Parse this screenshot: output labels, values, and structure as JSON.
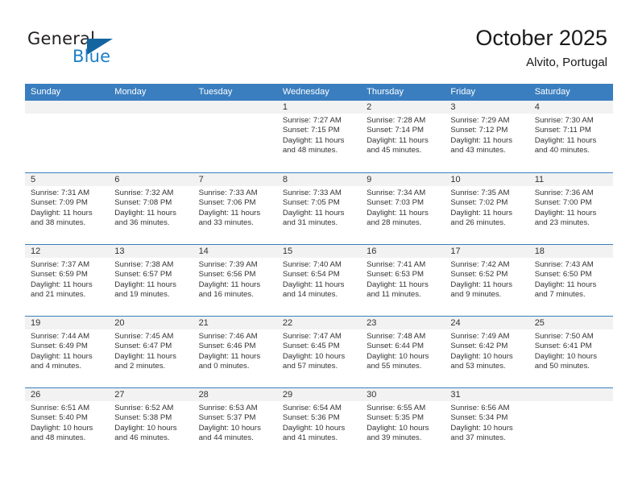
{
  "brand": {
    "name_part1": "General",
    "name_part2": "Blue",
    "accent_color": "#1f7fc4",
    "triangle_color": "#14659f"
  },
  "header": {
    "title": "October 2025",
    "subtitle": "Alvito, Portugal"
  },
  "calendar": {
    "header_bg": "#3a7ebf",
    "weekdays": [
      "Sunday",
      "Monday",
      "Tuesday",
      "Wednesday",
      "Thursday",
      "Friday",
      "Saturday"
    ],
    "weeks": [
      [
        {
          "day": "",
          "sunrise": "",
          "sunset": "",
          "daylight_line1": "",
          "daylight_line2": ""
        },
        {
          "day": "",
          "sunrise": "",
          "sunset": "",
          "daylight_line1": "",
          "daylight_line2": ""
        },
        {
          "day": "",
          "sunrise": "",
          "sunset": "",
          "daylight_line1": "",
          "daylight_line2": ""
        },
        {
          "day": "1",
          "sunrise": "Sunrise: 7:27 AM",
          "sunset": "Sunset: 7:15 PM",
          "daylight_line1": "Daylight: 11 hours",
          "daylight_line2": "and 48 minutes."
        },
        {
          "day": "2",
          "sunrise": "Sunrise: 7:28 AM",
          "sunset": "Sunset: 7:14 PM",
          "daylight_line1": "Daylight: 11 hours",
          "daylight_line2": "and 45 minutes."
        },
        {
          "day": "3",
          "sunrise": "Sunrise: 7:29 AM",
          "sunset": "Sunset: 7:12 PM",
          "daylight_line1": "Daylight: 11 hours",
          "daylight_line2": "and 43 minutes."
        },
        {
          "day": "4",
          "sunrise": "Sunrise: 7:30 AM",
          "sunset": "Sunset: 7:11 PM",
          "daylight_line1": "Daylight: 11 hours",
          "daylight_line2": "and 40 minutes."
        }
      ],
      [
        {
          "day": "5",
          "sunrise": "Sunrise: 7:31 AM",
          "sunset": "Sunset: 7:09 PM",
          "daylight_line1": "Daylight: 11 hours",
          "daylight_line2": "and 38 minutes."
        },
        {
          "day": "6",
          "sunrise": "Sunrise: 7:32 AM",
          "sunset": "Sunset: 7:08 PM",
          "daylight_line1": "Daylight: 11 hours",
          "daylight_line2": "and 36 minutes."
        },
        {
          "day": "7",
          "sunrise": "Sunrise: 7:33 AM",
          "sunset": "Sunset: 7:06 PM",
          "daylight_line1": "Daylight: 11 hours",
          "daylight_line2": "and 33 minutes."
        },
        {
          "day": "8",
          "sunrise": "Sunrise: 7:33 AM",
          "sunset": "Sunset: 7:05 PM",
          "daylight_line1": "Daylight: 11 hours",
          "daylight_line2": "and 31 minutes."
        },
        {
          "day": "9",
          "sunrise": "Sunrise: 7:34 AM",
          "sunset": "Sunset: 7:03 PM",
          "daylight_line1": "Daylight: 11 hours",
          "daylight_line2": "and 28 minutes."
        },
        {
          "day": "10",
          "sunrise": "Sunrise: 7:35 AM",
          "sunset": "Sunset: 7:02 PM",
          "daylight_line1": "Daylight: 11 hours",
          "daylight_line2": "and 26 minutes."
        },
        {
          "day": "11",
          "sunrise": "Sunrise: 7:36 AM",
          "sunset": "Sunset: 7:00 PM",
          "daylight_line1": "Daylight: 11 hours",
          "daylight_line2": "and 23 minutes."
        }
      ],
      [
        {
          "day": "12",
          "sunrise": "Sunrise: 7:37 AM",
          "sunset": "Sunset: 6:59 PM",
          "daylight_line1": "Daylight: 11 hours",
          "daylight_line2": "and 21 minutes."
        },
        {
          "day": "13",
          "sunrise": "Sunrise: 7:38 AM",
          "sunset": "Sunset: 6:57 PM",
          "daylight_line1": "Daylight: 11 hours",
          "daylight_line2": "and 19 minutes."
        },
        {
          "day": "14",
          "sunrise": "Sunrise: 7:39 AM",
          "sunset": "Sunset: 6:56 PM",
          "daylight_line1": "Daylight: 11 hours",
          "daylight_line2": "and 16 minutes."
        },
        {
          "day": "15",
          "sunrise": "Sunrise: 7:40 AM",
          "sunset": "Sunset: 6:54 PM",
          "daylight_line1": "Daylight: 11 hours",
          "daylight_line2": "and 14 minutes."
        },
        {
          "day": "16",
          "sunrise": "Sunrise: 7:41 AM",
          "sunset": "Sunset: 6:53 PM",
          "daylight_line1": "Daylight: 11 hours",
          "daylight_line2": "and 11 minutes."
        },
        {
          "day": "17",
          "sunrise": "Sunrise: 7:42 AM",
          "sunset": "Sunset: 6:52 PM",
          "daylight_line1": "Daylight: 11 hours",
          "daylight_line2": "and 9 minutes."
        },
        {
          "day": "18",
          "sunrise": "Sunrise: 7:43 AM",
          "sunset": "Sunset: 6:50 PM",
          "daylight_line1": "Daylight: 11 hours",
          "daylight_line2": "and 7 minutes."
        }
      ],
      [
        {
          "day": "19",
          "sunrise": "Sunrise: 7:44 AM",
          "sunset": "Sunset: 6:49 PM",
          "daylight_line1": "Daylight: 11 hours",
          "daylight_line2": "and 4 minutes."
        },
        {
          "day": "20",
          "sunrise": "Sunrise: 7:45 AM",
          "sunset": "Sunset: 6:47 PM",
          "daylight_line1": "Daylight: 11 hours",
          "daylight_line2": "and 2 minutes."
        },
        {
          "day": "21",
          "sunrise": "Sunrise: 7:46 AM",
          "sunset": "Sunset: 6:46 PM",
          "daylight_line1": "Daylight: 11 hours",
          "daylight_line2": "and 0 minutes."
        },
        {
          "day": "22",
          "sunrise": "Sunrise: 7:47 AM",
          "sunset": "Sunset: 6:45 PM",
          "daylight_line1": "Daylight: 10 hours",
          "daylight_line2": "and 57 minutes."
        },
        {
          "day": "23",
          "sunrise": "Sunrise: 7:48 AM",
          "sunset": "Sunset: 6:44 PM",
          "daylight_line1": "Daylight: 10 hours",
          "daylight_line2": "and 55 minutes."
        },
        {
          "day": "24",
          "sunrise": "Sunrise: 7:49 AM",
          "sunset": "Sunset: 6:42 PM",
          "daylight_line1": "Daylight: 10 hours",
          "daylight_line2": "and 53 minutes."
        },
        {
          "day": "25",
          "sunrise": "Sunrise: 7:50 AM",
          "sunset": "Sunset: 6:41 PM",
          "daylight_line1": "Daylight: 10 hours",
          "daylight_line2": "and 50 minutes."
        }
      ],
      [
        {
          "day": "26",
          "sunrise": "Sunrise: 6:51 AM",
          "sunset": "Sunset: 5:40 PM",
          "daylight_line1": "Daylight: 10 hours",
          "daylight_line2": "and 48 minutes."
        },
        {
          "day": "27",
          "sunrise": "Sunrise: 6:52 AM",
          "sunset": "Sunset: 5:38 PM",
          "daylight_line1": "Daylight: 10 hours",
          "daylight_line2": "and 46 minutes."
        },
        {
          "day": "28",
          "sunrise": "Sunrise: 6:53 AM",
          "sunset": "Sunset: 5:37 PM",
          "daylight_line1": "Daylight: 10 hours",
          "daylight_line2": "and 44 minutes."
        },
        {
          "day": "29",
          "sunrise": "Sunrise: 6:54 AM",
          "sunset": "Sunset: 5:36 PM",
          "daylight_line1": "Daylight: 10 hours",
          "daylight_line2": "and 41 minutes."
        },
        {
          "day": "30",
          "sunrise": "Sunrise: 6:55 AM",
          "sunset": "Sunset: 5:35 PM",
          "daylight_line1": "Daylight: 10 hours",
          "daylight_line2": "and 39 minutes."
        },
        {
          "day": "31",
          "sunrise": "Sunrise: 6:56 AM",
          "sunset": "Sunset: 5:34 PM",
          "daylight_line1": "Daylight: 10 hours",
          "daylight_line2": "and 37 minutes."
        },
        {
          "day": "",
          "sunrise": "",
          "sunset": "",
          "daylight_line1": "",
          "daylight_line2": ""
        }
      ]
    ]
  }
}
